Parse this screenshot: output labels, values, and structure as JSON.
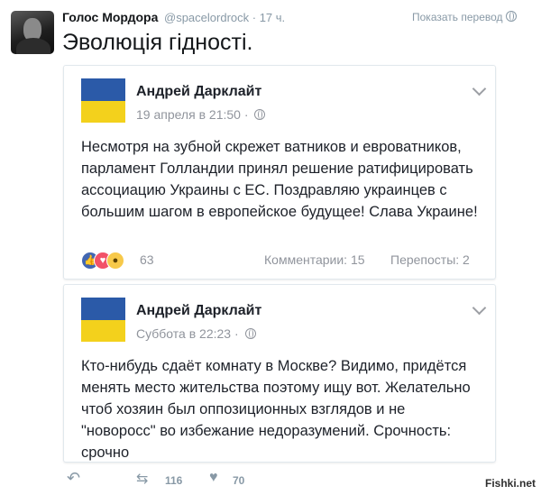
{
  "tweet": {
    "author_name": "Голос Мордора",
    "handle": "@spacelordrock",
    "time": "· 17 ч.",
    "show_translation": "Показать перевод",
    "text": "Эволюція гідності."
  },
  "posts": [
    {
      "author": "Андрей Дарклайт",
      "meta": "19 апреля в 21:50 ·",
      "body": "Несмотря на зубной скрежет ватников и евроватников, парламент Голландии принял решение ратифицировать ассоциацию Украины с ЕС. Поздравляю украинцев с большим шагом в европейское будущее! Слава Украине!",
      "reaction_count": "63",
      "comments": "Комментарии: 15",
      "shares": "Перепосты: 2"
    },
    {
      "author": "Андрей Дарклайт",
      "meta": "Суббота в 22:23 ·",
      "body": "Кто-нибудь сдаёт комнату в Москве? Видимо, придётся менять место жительства поэтому ищу вот. Желательно чтоб хозяин был оппозиционных взглядов и не \"новоросс\" во избежание недоразумений. Срочность: срочно"
    }
  ],
  "actions": {
    "retweets": "116",
    "likes": "70"
  },
  "watermark": "Fishki.net",
  "colors": {
    "flag_blue": "#2b5aa8",
    "flag_yellow": "#f3d11c",
    "muted": "#8899a6"
  }
}
